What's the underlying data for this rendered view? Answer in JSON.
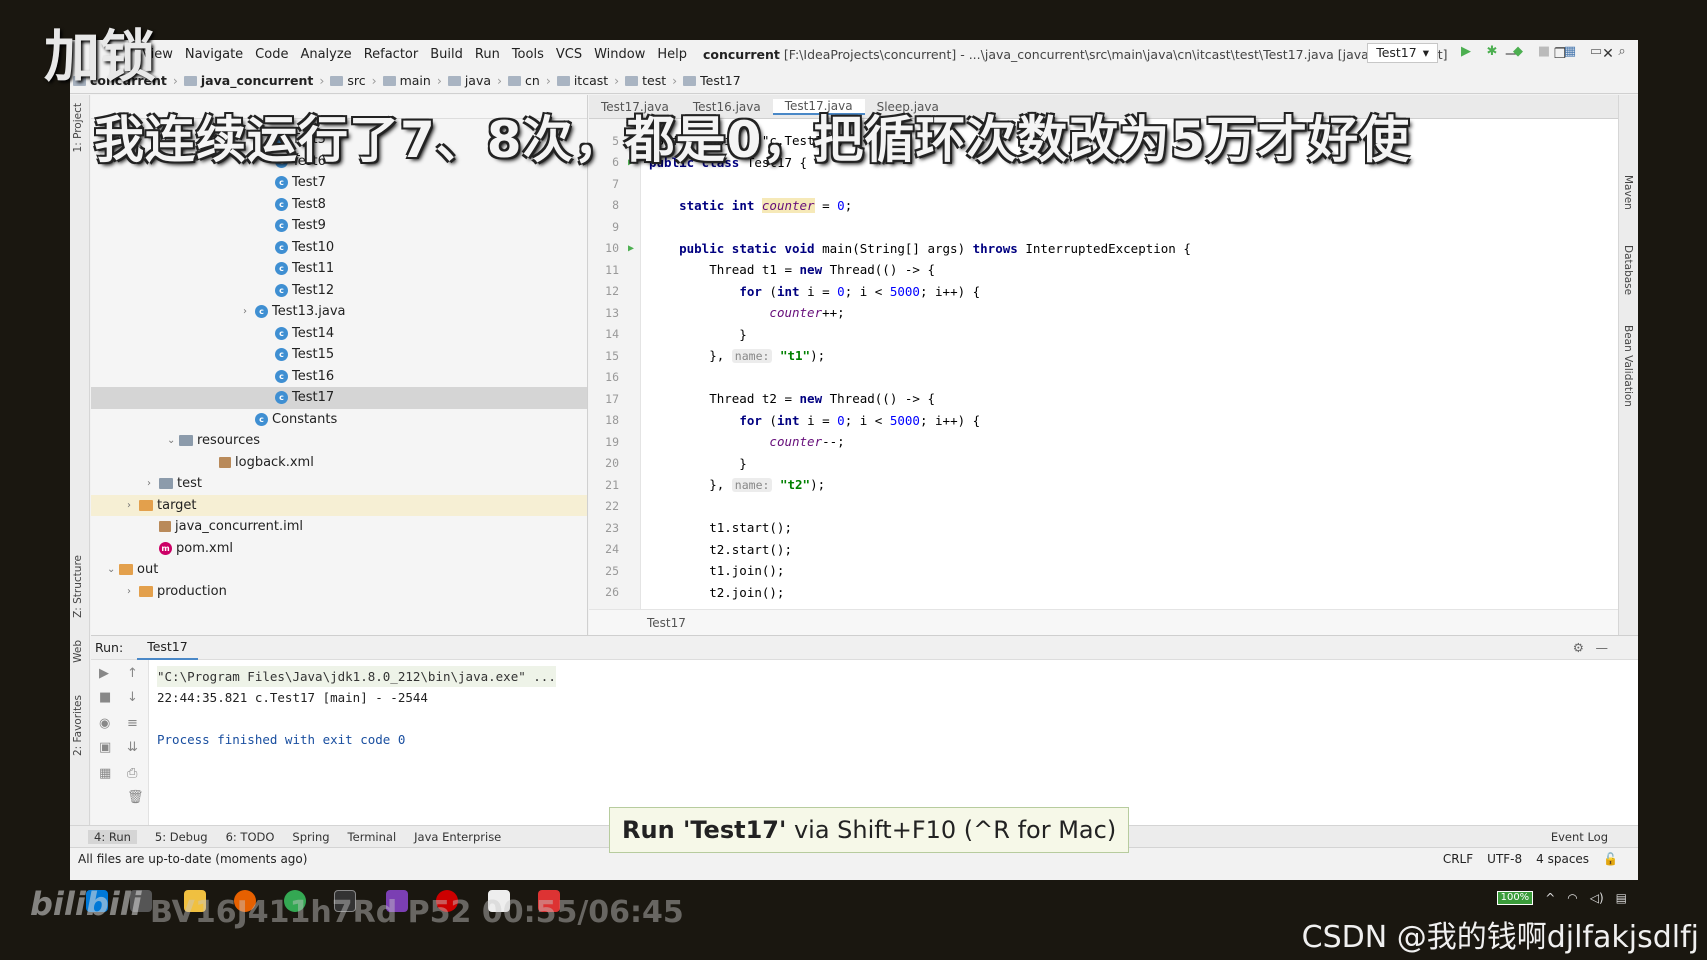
{
  "overlay": {
    "title": "加锁",
    "caption": "我连续运行了7、8次，都是0，把循环次数改为5万才好使",
    "watermark": "BV16J411h7Rd P52 00:55/06:45",
    "bilibili_logo": "bilibili",
    "csdn": "CSDN @我的钱啊djlfakjsdlfj"
  },
  "menubar": {
    "items": [
      "View",
      "Navigate",
      "Code",
      "Analyze",
      "Refactor",
      "Build",
      "Run",
      "Tools",
      "VCS",
      "Window",
      "Help"
    ],
    "window_title_bold": "concurrent",
    "window_title_rest": "[F:\\IdeaProjects\\concurrent] - ...\\java_concurrent\\src\\main\\java\\cn\\itcast\\test\\Test17.java [java_concurrent]"
  },
  "breadcrumbs": [
    "concurrent",
    "java_concurrent",
    "src",
    "main",
    "java",
    "cn",
    "itcast",
    "test",
    "Test17"
  ],
  "run_config": "Test17",
  "project_tree": [
    {
      "label": "Test5",
      "kind": "class",
      "indent": 172
    },
    {
      "label": "Test6",
      "kind": "class",
      "indent": 172
    },
    {
      "label": "Test7",
      "kind": "class",
      "indent": 172
    },
    {
      "label": "Test8",
      "kind": "class",
      "indent": 172
    },
    {
      "label": "Test9",
      "kind": "class",
      "indent": 172
    },
    {
      "label": "Test10",
      "kind": "class",
      "indent": 172
    },
    {
      "label": "Test11",
      "kind": "class",
      "indent": 172
    },
    {
      "label": "Test12",
      "kind": "class",
      "indent": 172
    },
    {
      "label": "Test13.java",
      "kind": "class",
      "indent": 152,
      "arrow": "›"
    },
    {
      "label": "Test14",
      "kind": "class",
      "indent": 172
    },
    {
      "label": "Test15",
      "kind": "class",
      "indent": 172
    },
    {
      "label": "Test16",
      "kind": "class",
      "indent": 172
    },
    {
      "label": "Test17",
      "kind": "class",
      "indent": 172,
      "selected": true
    },
    {
      "label": "Constants",
      "kind": "class",
      "indent": 152
    },
    {
      "label": "resources",
      "kind": "folder",
      "indent": 76,
      "arrow": "⌄"
    },
    {
      "label": "logback.xml",
      "kind": "file",
      "indent": 116
    },
    {
      "label": "test",
      "kind": "folder",
      "indent": 56,
      "arrow": "›"
    },
    {
      "label": "target",
      "kind": "folder-orange",
      "indent": 36,
      "arrow": "›",
      "highlight": true
    },
    {
      "label": "java_concurrent.iml",
      "kind": "file",
      "indent": 56
    },
    {
      "label": "pom.xml",
      "kind": "maven",
      "indent": 56
    },
    {
      "label": "out",
      "kind": "folder-orange",
      "indent": 16,
      "arrow": "⌄"
    },
    {
      "label": "production",
      "kind": "folder-orange",
      "indent": 36,
      "arrow": "›"
    }
  ],
  "editor": {
    "tab_labels": [
      "Test17.java",
      "Test16.java",
      "Test17.java",
      "Sleep.java"
    ],
    "breadcrumb": "Test17",
    "lines": [
      {
        "n": "5",
        "parts": [
          [
            "",
            "@Slf4j(topic = \"c.Test17\")"
          ]
        ]
      },
      {
        "n": "6",
        "run": true,
        "parts": [
          [
            "kw",
            "public class "
          ],
          [
            "",
            "Test17 {"
          ]
        ]
      },
      {
        "n": "7",
        "parts": []
      },
      {
        "n": "8",
        "parts": [
          [
            "",
            "    "
          ],
          [
            "kw",
            "static int "
          ],
          [
            "fld hlv",
            "counter"
          ],
          [
            "",
            " = "
          ],
          [
            "num",
            "0"
          ],
          [
            "",
            ";"
          ]
        ]
      },
      {
        "n": "9",
        "parts": []
      },
      {
        "n": "10",
        "run": true,
        "parts": [
          [
            "",
            "    "
          ],
          [
            "kw",
            "public static void "
          ],
          [
            "",
            "main(String[] args) "
          ],
          [
            "kw",
            "throws "
          ],
          [
            "",
            "InterruptedException {"
          ]
        ]
      },
      {
        "n": "11",
        "parts": [
          [
            "",
            "        Thread t1 = "
          ],
          [
            "kw",
            "new "
          ],
          [
            "",
            "Thread(() -> {"
          ]
        ]
      },
      {
        "n": "12",
        "parts": [
          [
            "",
            "            "
          ],
          [
            "kw",
            "for "
          ],
          [
            "",
            "("
          ],
          [
            "kw",
            "int "
          ],
          [
            "",
            "i = "
          ],
          [
            "num",
            "0"
          ],
          [
            "",
            "; i < "
          ],
          [
            "num",
            "5000"
          ],
          [
            "",
            "; i++) {"
          ]
        ]
      },
      {
        "n": "13",
        "parts": [
          [
            "",
            "                "
          ],
          [
            "fld",
            "counter"
          ],
          [
            "",
            "++;"
          ]
        ]
      },
      {
        "n": "14",
        "parts": [
          [
            "",
            "            }"
          ]
        ]
      },
      {
        "n": "15",
        "parts": [
          [
            "",
            "        }, "
          ],
          [
            "hint",
            "name:"
          ],
          [
            "",
            " "
          ],
          [
            "str",
            "\"t1\""
          ],
          [
            "",
            ");"
          ]
        ]
      },
      {
        "n": "16",
        "parts": []
      },
      {
        "n": "17",
        "parts": [
          [
            "",
            "        Thread t2 = "
          ],
          [
            "kw",
            "new "
          ],
          [
            "",
            "Thread(() -> {"
          ]
        ]
      },
      {
        "n": "18",
        "parts": [
          [
            "",
            "            "
          ],
          [
            "kw",
            "for "
          ],
          [
            "",
            "("
          ],
          [
            "kw",
            "int "
          ],
          [
            "",
            "i = "
          ],
          [
            "num",
            "0"
          ],
          [
            "",
            "; i < "
          ],
          [
            "num",
            "5000"
          ],
          [
            "",
            "; i++) {"
          ]
        ]
      },
      {
        "n": "19",
        "parts": [
          [
            "",
            "                "
          ],
          [
            "fld",
            "counter"
          ],
          [
            "",
            "--;"
          ]
        ]
      },
      {
        "n": "20",
        "parts": [
          [
            "",
            "            }"
          ]
        ]
      },
      {
        "n": "21",
        "parts": [
          [
            "",
            "        }, "
          ],
          [
            "hint",
            "name:"
          ],
          [
            "",
            " "
          ],
          [
            "str",
            "\"t2\""
          ],
          [
            "",
            ");"
          ]
        ]
      },
      {
        "n": "22",
        "parts": []
      },
      {
        "n": "23",
        "parts": [
          [
            "",
            "        t1.start();"
          ]
        ]
      },
      {
        "n": "24",
        "parts": [
          [
            "",
            "        t2.start();"
          ]
        ]
      },
      {
        "n": "25",
        "parts": [
          [
            "",
            "        t1.join();"
          ]
        ]
      },
      {
        "n": "26",
        "parts": [
          [
            "",
            "        t2.join();"
          ]
        ]
      }
    ]
  },
  "run_panel": {
    "label": "Run:",
    "tab": "Test17",
    "console": {
      "cmd": "\"C:\\Program Files\\Java\\jdk1.8.0_212\\bin\\java.exe\" ...",
      "log": "22:44:35.821 c.Test17 [main] - -2544",
      "exit": "Process finished with exit code 0"
    }
  },
  "tooltip": {
    "bold": "Run 'Test17'",
    "rest": " via Shift+F10 (^R for Mac)"
  },
  "bottom_tools": [
    "4: Run",
    "5: Debug",
    "6: TODO",
    "Spring",
    "Terminal",
    "Java Enterprise"
  ],
  "event_log": "Event Log",
  "status": {
    "message": "All files are up-to-date (moments ago)",
    "line_sep": "CRLF",
    "encoding": "UTF-8",
    "indent": "4 spaces"
  },
  "side_labels": {
    "project": "1: Project",
    "structure": "Z: Structure",
    "web": "Web",
    "favorites": "2: Favorites",
    "maven": "Maven",
    "database": "Database",
    "bean": "Bean Validation"
  },
  "tray": {
    "battery": "100%"
  }
}
